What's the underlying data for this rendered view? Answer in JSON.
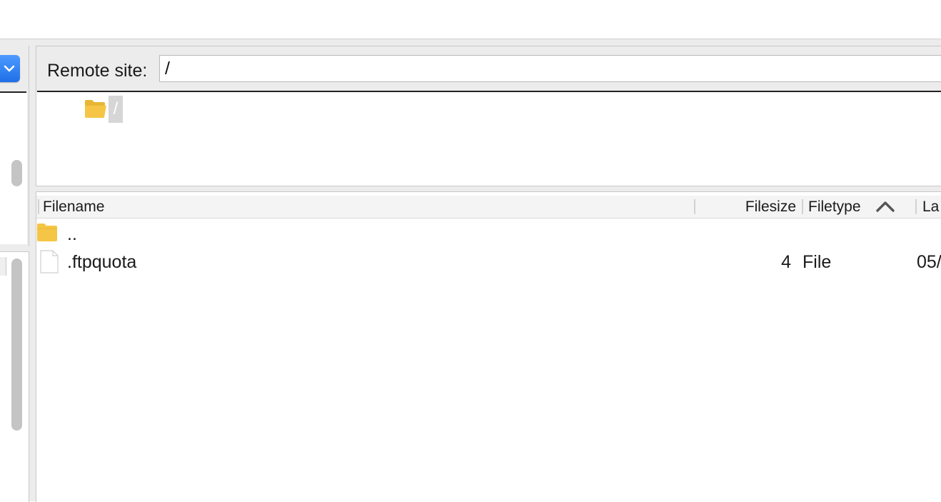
{
  "remote": {
    "label": "Remote site:",
    "path": "/"
  },
  "tree": {
    "root_label": "/"
  },
  "file_list": {
    "columns": {
      "filename": "Filename",
      "filesize": "Filesize",
      "filetype": "Filetype",
      "last_modified": "La"
    },
    "sort": {
      "column": "filetype",
      "direction": "ascending"
    },
    "rows": [
      {
        "name": "..",
        "size": "",
        "type": "",
        "modified": "",
        "icon": "folder-icon"
      },
      {
        "name": ".ftpquota",
        "size": "4",
        "type": "File",
        "modified": "05/",
        "icon": "file-icon"
      }
    ]
  },
  "colors": {
    "folder": "#f5c645",
    "accent": "#2f7cf6",
    "pane_bg": "#ececec",
    "tree_selection": "#d6d6d6"
  }
}
